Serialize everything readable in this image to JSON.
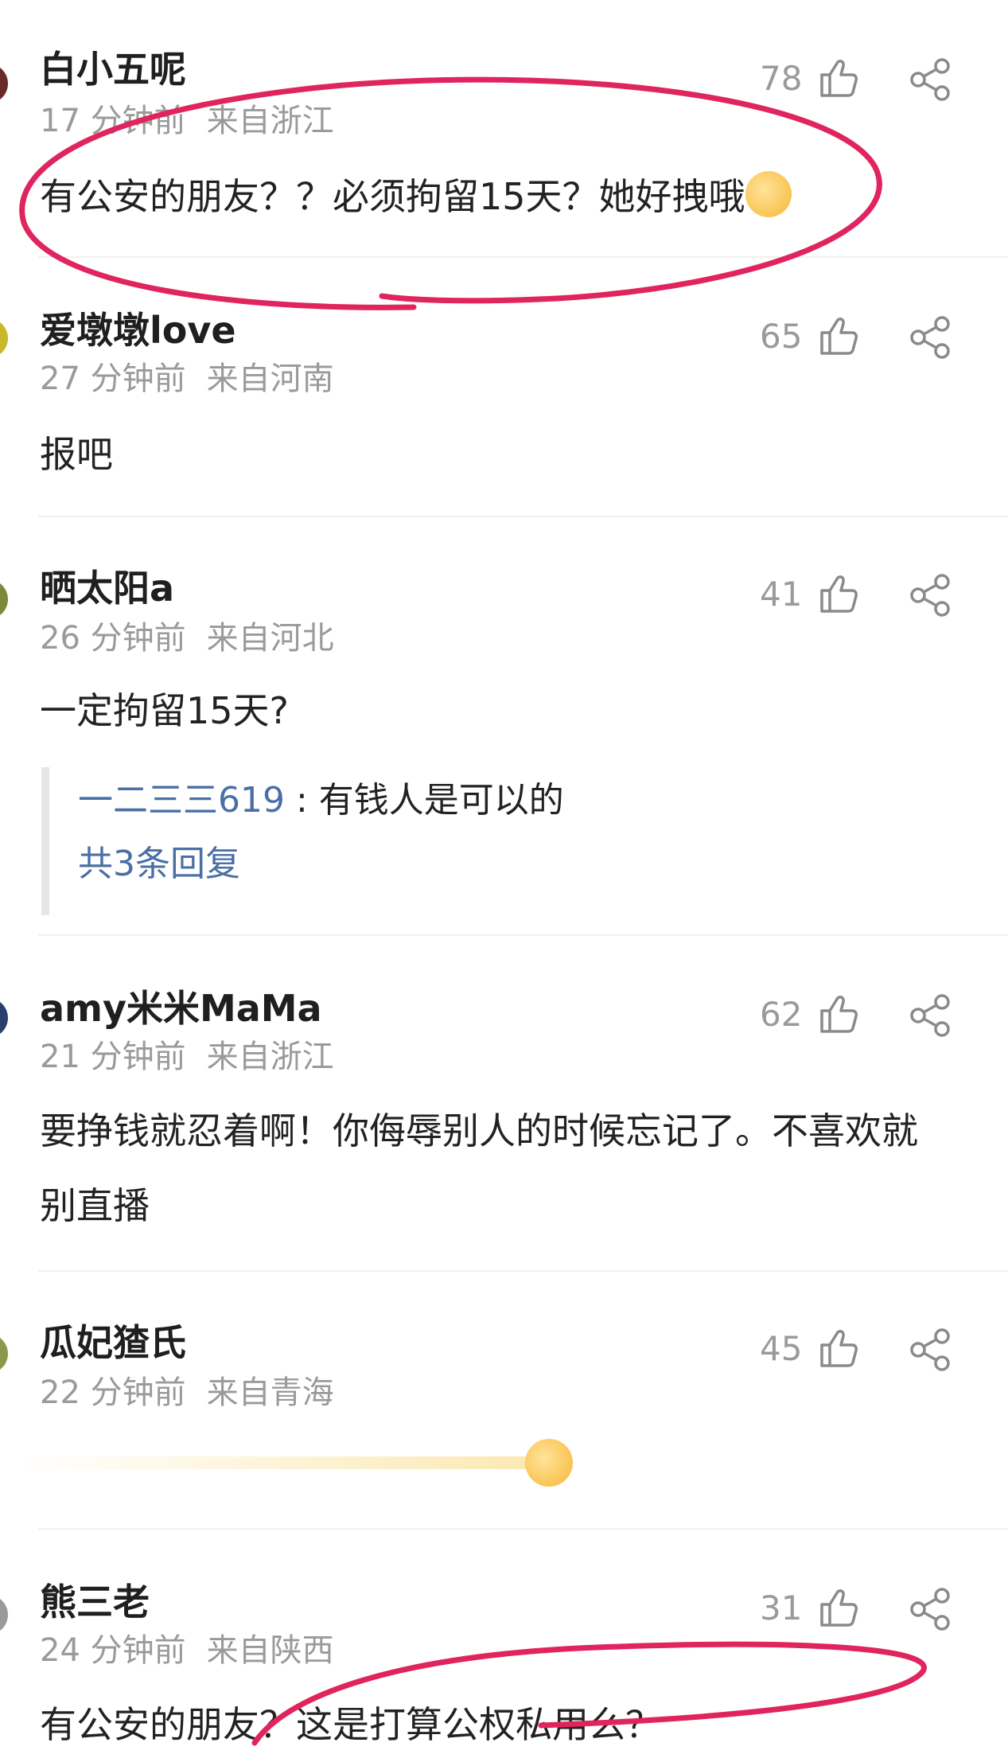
{
  "comments": [
    {
      "username": "白小五呢",
      "time": "17 分钟前",
      "location": "来自浙江",
      "text": "有公安的朋友？？必须拘留15天？她好拽哦",
      "likes": "78",
      "emoji": "hide-face-emoji",
      "avatar_color": "#6b2a2a"
    },
    {
      "username": "爱墩墩love",
      "time": "27 分钟前",
      "location": "来自河南",
      "text": "报吧",
      "likes": "65",
      "avatar_color": "#c9b82a"
    },
    {
      "username": "晒太阳a",
      "time": "26 分钟前",
      "location": "来自河北",
      "text": "一定拘留15天?",
      "likes": "41",
      "avatar_color": "#7a8a3a",
      "reply": {
        "user": "一二三三619",
        "sep": " : ",
        "text": "有钱人是可以的",
        "more": "共3条回复"
      }
    },
    {
      "username": "amy米米MaMa",
      "time": "21 分钟前",
      "location": "来自浙江",
      "text": "要挣钱就忍着啊！你侮辱别人的时候忘记了。不喜欢就别直播",
      "likes": "62",
      "avatar_color": "#2a3f6b"
    },
    {
      "username": "瓜妃猹氏",
      "time": "22 分钟前",
      "location": "来自青海",
      "text": "",
      "likes": "45",
      "emoji": "dash-emoji",
      "avatar_color": "#8a9a4a"
    },
    {
      "username": "熊三老",
      "time": "24 分钟前",
      "location": "来自陕西",
      "text": "有公安的朋友？这是打算公权私用么？",
      "likes": "31",
      "avatar_color": "#9a9a9a"
    }
  ],
  "colors": {
    "annotation": "#e0245e",
    "link": "#4a6fa5",
    "meta": "#9a9a9a"
  },
  "icons": {
    "like": "thumbs-up-icon",
    "share": "share-icon"
  }
}
